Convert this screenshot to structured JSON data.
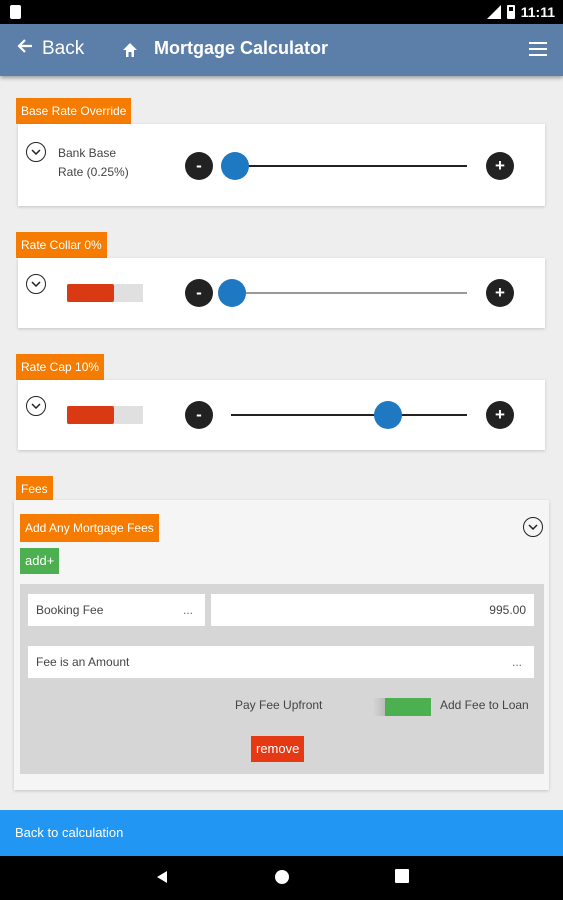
{
  "status_bar": {
    "time": "11:11"
  },
  "app_bar": {
    "back_label": "Back",
    "title": "Mortgage Calculator"
  },
  "base_rate": {
    "tag": "Base Rate Override",
    "label_line1": "Bank Base",
    "label_line2": "Rate (0.25%)",
    "slider_value": 0.0,
    "minus": "-",
    "plus": "+"
  },
  "rate_collar": {
    "tag": "Rate Collar 0%",
    "toggle_fill": 0.62,
    "slider_value": 0.0,
    "minus": "-",
    "plus": "+"
  },
  "rate_cap": {
    "tag": "Rate Cap 10%",
    "toggle_fill": 0.62,
    "slider_value": 0.66,
    "minus": "-",
    "plus": "+"
  },
  "fees": {
    "tag": "Fees",
    "add_any_label": "Add Any Mortgage Fees",
    "add_button": "add+",
    "fee_name": "Booking Fee",
    "fee_name_more": "...",
    "fee_amount": "995.00",
    "fee_type": "Fee is an Amount",
    "fee_type_more": "...",
    "pay_upfront_label": "Pay Fee Upfront",
    "add_to_loan_label": "Add Fee to Loan",
    "add_to_loan_on": true,
    "remove_button": "remove"
  },
  "bottom": {
    "back_to_calc": "Back to calculation"
  },
  "colors": {
    "app_bar": "#5b7fa8",
    "tag_orange": "#f57c00",
    "slider_blue": "#1e78c2",
    "toggle_red": "#d93a14",
    "add_green": "#4caf50",
    "remove_red": "#e53914",
    "bottom_blue": "#2196f3"
  }
}
